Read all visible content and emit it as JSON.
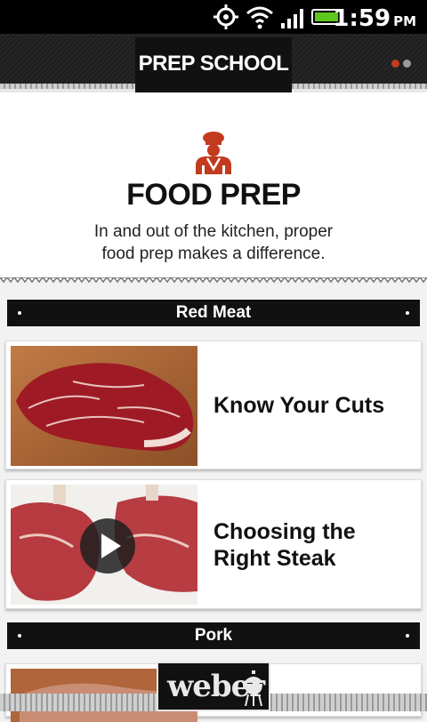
{
  "status_bar": {
    "time": "1:59",
    "ampm": "PM",
    "icons": [
      "gps-icon",
      "wifi-icon",
      "signal-icon",
      "battery-icon"
    ]
  },
  "header": {
    "title": "PREP SCHOOL",
    "page_dots": {
      "count": 2,
      "active_index": 0,
      "active_color": "#c23b1e",
      "inactive_color": "#9a9a9a"
    }
  },
  "hero": {
    "icon": "chef-icon",
    "icon_color": "#c23b1e",
    "title": "FOOD PREP",
    "description": "In and out of the kitchen, proper food prep makes a difference."
  },
  "sections": [
    {
      "label": "Red Meat",
      "items": [
        {
          "label": "Know Your Cuts",
          "thumb": "raw-steak-photo",
          "has_video": false
        },
        {
          "label": "Choosing the Right Steak",
          "thumb": "rib-steaks-photo",
          "has_video": true
        }
      ]
    },
    {
      "label": "Pork",
      "items": []
    }
  ],
  "footer": {
    "logo": "weber",
    "logo_icon": "grill-icon"
  }
}
